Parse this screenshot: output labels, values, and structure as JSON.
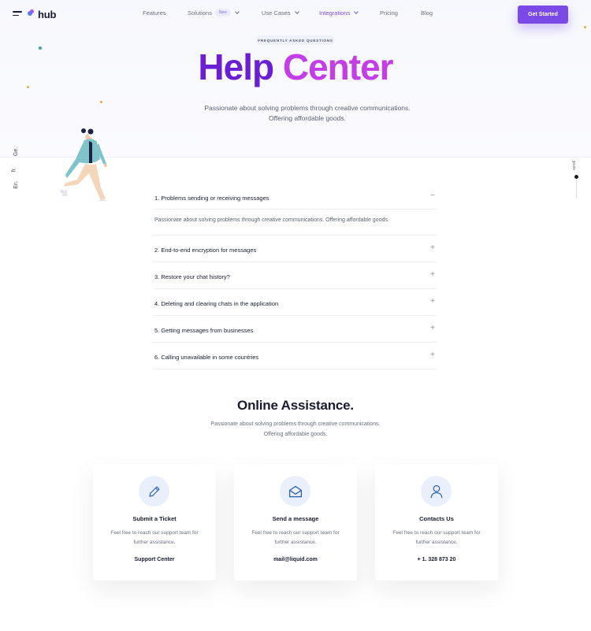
{
  "brand": {
    "name": "hub",
    "accent": "#7b4ae6"
  },
  "nav": {
    "items": [
      {
        "label": "Features"
      },
      {
        "label": "Solutions",
        "badge": "New"
      },
      {
        "label": "Use Cases"
      },
      {
        "label": "Integrations"
      },
      {
        "label": "Pricing"
      },
      {
        "label": "Blog"
      }
    ],
    "cta": "Get Started"
  },
  "languages": [
    "Ge.",
    "fr.",
    "En."
  ],
  "scroll_label": "scroll",
  "hero": {
    "eyebrow": "FREQUENTLY ASKED QUESTIONS",
    "title_part1": "Help",
    "title_part2": "Center",
    "subtitle": "Passionate about solving problems through creative communications. Offering affordable goods."
  },
  "faq": {
    "items": [
      {
        "question": "1. Problems sending or receiving messages",
        "expanded": true,
        "answer": "Passionate about solving problems through creative communications. Offering affordable goods."
      },
      {
        "question": "2. End-to-end encryption for messages",
        "expanded": false
      },
      {
        "question": "3. Restore your chat history?",
        "expanded": false
      },
      {
        "question": "4. Deleting and clearing chats in the application",
        "expanded": false
      },
      {
        "question": "5. Getting messages from businesses",
        "expanded": false
      },
      {
        "question": "6. Calling unavailable in some countries",
        "expanded": false
      }
    ],
    "collapse_sign": "−",
    "expand_sign": "+"
  },
  "assistance": {
    "title": "Online Assistance.",
    "subtitle_line1": "Passionate about solving problems through creative communications.",
    "subtitle_line2": "Offering affordable goods.",
    "cards": [
      {
        "icon": "pencil-icon",
        "title": "Submit a Ticket",
        "text": "Feel free to reach our support team for further assistance.",
        "link": "Support Center"
      },
      {
        "icon": "envelope-icon",
        "title": "Send a message",
        "text": "Feel free to reach our support team for further assistance.",
        "link": "mail@liquid.com"
      },
      {
        "icon": "user-icon",
        "title": "Contacts Us",
        "text": "Feel free to reach our support team for further assistance.",
        "link": "+ 1. 328 873 20"
      }
    ]
  }
}
